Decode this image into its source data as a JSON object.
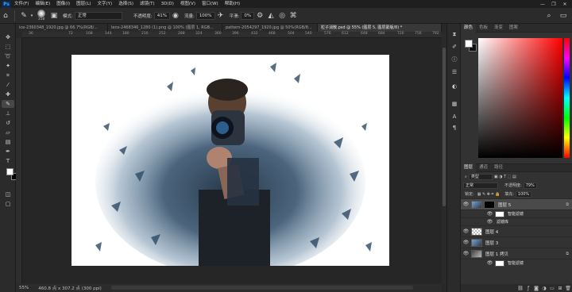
{
  "app": {
    "logo": "Ps"
  },
  "menu": [
    "文件(F)",
    "编辑(E)",
    "图像(I)",
    "图层(L)",
    "文字(Y)",
    "选择(S)",
    "滤镜(T)",
    "3D(D)",
    "视图(V)",
    "窗口(W)",
    "帮助(H)"
  ],
  "window_controls": [
    "—",
    "❐",
    "✕"
  ],
  "options": {
    "brush_size": "358",
    "mode_label": "模式:",
    "mode_value": "正常",
    "opacity_label": "不透明度:",
    "opacity_value": "41%",
    "flow_label": "流量:",
    "flow_value": "100%",
    "smooth_label": "平滑:",
    "smooth_value": "0%"
  },
  "tabs": [
    {
      "label": "ice-2360348_1920.jpg @ 66.7%(RGB/...",
      "active": false
    },
    {
      "label": "lens-2468346_1280 (1).png @ 100% (图层 1, RGB...",
      "active": false
    },
    {
      "label": "pattern-2054297_1920.jpg @ 50%(RGB/8...",
      "active": false
    },
    {
      "label": "粒子消散.psd @ 55% (图层 5, 图层蒙版/8) *",
      "active": true
    }
  ],
  "ruler_ticks": [
    "36",
    "72",
    "108",
    "144",
    "180",
    "216",
    "252",
    "288",
    "324",
    "360",
    "396",
    "432",
    "468",
    "504",
    "540",
    "576",
    "612",
    "648",
    "684",
    "720",
    "756",
    "792"
  ],
  "status": {
    "zoom": "55%",
    "doc": "460.8 点 x 307.2 点 (300 ppi)"
  },
  "color_panel": {
    "tabs": [
      "颜色",
      "色板",
      "渐变",
      "图案"
    ]
  },
  "layers_panel": {
    "tabs": [
      "图层",
      "通道",
      "路径"
    ],
    "kind_label": "类型",
    "blend": "正常",
    "opacity_label": "不透明度:",
    "opacity": "79%",
    "lock_label": "锁定:",
    "fill_label": "填充:",
    "fill": "100%",
    "layers": [
      {
        "name": "图层 5",
        "selected": true,
        "thumb": "photo",
        "mask": true
      },
      {
        "name": "智能滤镜",
        "sub": true
      },
      {
        "name": "滤镜库",
        "sub": true
      },
      {
        "name": "图层 4",
        "selected": false,
        "thumb": "checker"
      },
      {
        "name": "图层 3",
        "selected": false,
        "thumb": "photo"
      },
      {
        "name": "图层 1 拷贝",
        "selected": false,
        "thumb": "photo2"
      },
      {
        "name": "智能滤镜",
        "sub": true
      }
    ]
  }
}
